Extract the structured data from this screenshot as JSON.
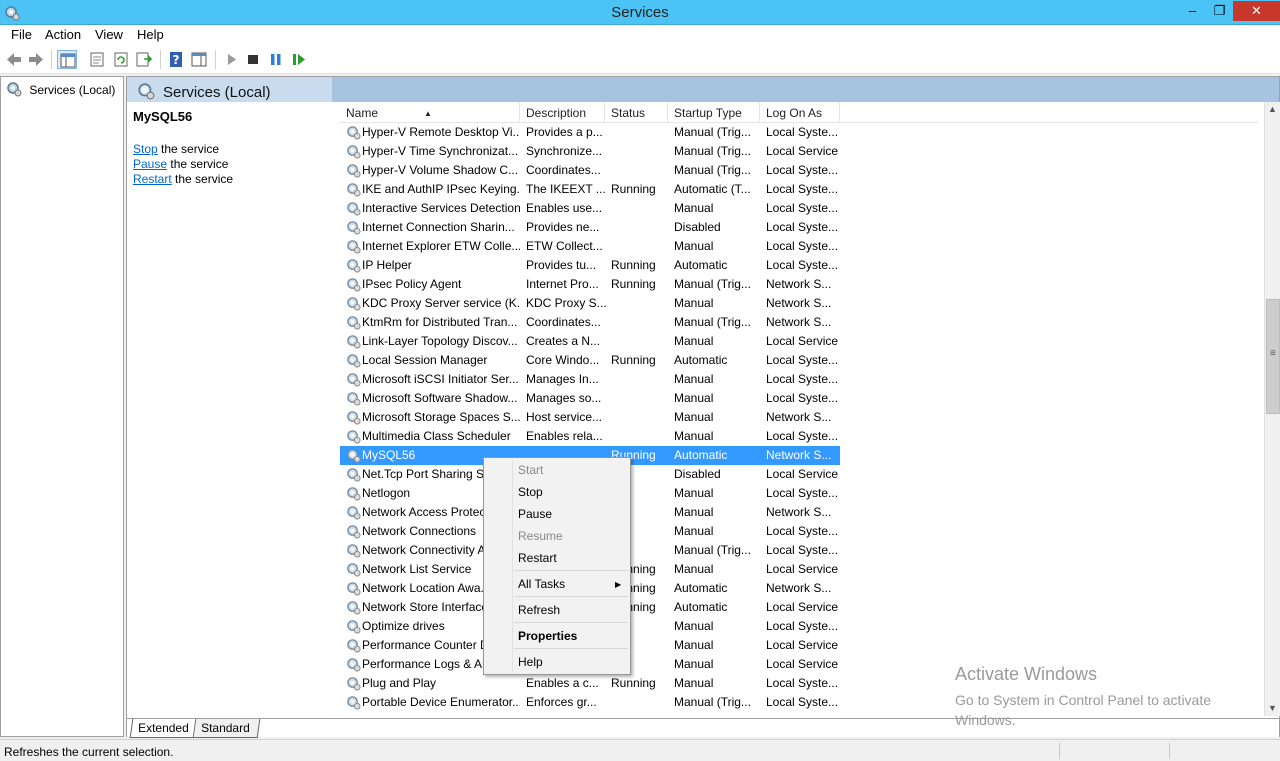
{
  "window": {
    "title": "Services"
  },
  "menubar": {
    "items": [
      "File",
      "Action",
      "View",
      "Help"
    ]
  },
  "tree": {
    "root_label": "Services (Local)"
  },
  "main": {
    "header_title": "Services (Local)",
    "selected_service": "MySQL56",
    "actions": [
      {
        "link": "Stop",
        "rest": "the service"
      },
      {
        "link": "Pause",
        "rest": "the service"
      },
      {
        "link": "Restart",
        "rest": "the service"
      }
    ]
  },
  "table": {
    "columns": [
      "Name",
      "Description",
      "Status",
      "Startup Type",
      "Log On As"
    ],
    "rows": [
      {
        "name": "Hyper-V Remote Desktop Vi...",
        "desc": "Provides a p...",
        "status": "",
        "startup": "Manual (Trig...",
        "logon": "Local Syste..."
      },
      {
        "name": "Hyper-V Time Synchronizat...",
        "desc": "Synchronize...",
        "status": "",
        "startup": "Manual (Trig...",
        "logon": "Local Service"
      },
      {
        "name": "Hyper-V Volume Shadow C...",
        "desc": "Coordinates...",
        "status": "",
        "startup": "Manual (Trig...",
        "logon": "Local Syste..."
      },
      {
        "name": "IKE and AuthIP IPsec Keying...",
        "desc": "The IKEEXT ...",
        "status": "Running",
        "startup": "Automatic (T...",
        "logon": "Local Syste..."
      },
      {
        "name": "Interactive Services Detection",
        "desc": "Enables use...",
        "status": "",
        "startup": "Manual",
        "logon": "Local Syste..."
      },
      {
        "name": "Internet Connection Sharin...",
        "desc": "Provides ne...",
        "status": "",
        "startup": "Disabled",
        "logon": "Local Syste..."
      },
      {
        "name": "Internet Explorer ETW Colle...",
        "desc": "ETW Collect...",
        "status": "",
        "startup": "Manual",
        "logon": "Local Syste..."
      },
      {
        "name": "IP Helper",
        "desc": "Provides tu...",
        "status": "Running",
        "startup": "Automatic",
        "logon": "Local Syste..."
      },
      {
        "name": "IPsec Policy Agent",
        "desc": "Internet Pro...",
        "status": "Running",
        "startup": "Manual (Trig...",
        "logon": "Network S..."
      },
      {
        "name": "KDC Proxy Server service (K...",
        "desc": "KDC Proxy S...",
        "status": "",
        "startup": "Manual",
        "logon": "Network S..."
      },
      {
        "name": "KtmRm for Distributed Tran...",
        "desc": "Coordinates...",
        "status": "",
        "startup": "Manual (Trig...",
        "logon": "Network S..."
      },
      {
        "name": "Link-Layer Topology Discov...",
        "desc": "Creates a N...",
        "status": "",
        "startup": "Manual",
        "logon": "Local Service"
      },
      {
        "name": "Local Session Manager",
        "desc": "Core Windo...",
        "status": "Running",
        "startup": "Automatic",
        "logon": "Local Syste..."
      },
      {
        "name": "Microsoft iSCSI Initiator Ser...",
        "desc": "Manages In...",
        "status": "",
        "startup": "Manual",
        "logon": "Local Syste..."
      },
      {
        "name": "Microsoft Software Shadow...",
        "desc": "Manages so...",
        "status": "",
        "startup": "Manual",
        "logon": "Local Syste..."
      },
      {
        "name": "Microsoft Storage Spaces S...",
        "desc": "Host service...",
        "status": "",
        "startup": "Manual",
        "logon": "Network S..."
      },
      {
        "name": "Multimedia Class Scheduler",
        "desc": "Enables rela...",
        "status": "",
        "startup": "Manual",
        "logon": "Local Syste..."
      },
      {
        "name": "MySQL56",
        "desc": "",
        "status": "Running",
        "startup": "Automatic",
        "logon": "Network S...",
        "selected": true
      },
      {
        "name": "Net.Tcp Port Sharing Se...",
        "desc": "",
        "status": "",
        "startup": "Disabled",
        "logon": "Local Service"
      },
      {
        "name": "Netlogon",
        "desc": "",
        "status": "",
        "startup": "Manual",
        "logon": "Local Syste..."
      },
      {
        "name": "Network Access Protec...",
        "desc": "",
        "status": "",
        "startup": "Manual",
        "logon": "Network S..."
      },
      {
        "name": "Network Connections",
        "desc": "",
        "status": "",
        "startup": "Manual",
        "logon": "Local Syste..."
      },
      {
        "name": "Network Connectivity A...",
        "desc": "",
        "status": "",
        "startup": "Manual (Trig...",
        "logon": "Local Syste..."
      },
      {
        "name": "Network List Service",
        "desc": "",
        "status": "Running",
        "startup": "Manual",
        "logon": "Local Service"
      },
      {
        "name": "Network Location Awa...",
        "desc": "",
        "status": "Running",
        "startup": "Automatic",
        "logon": "Network S..."
      },
      {
        "name": "Network Store Interface...",
        "desc": "",
        "status": "Running",
        "startup": "Automatic",
        "logon": "Local Service"
      },
      {
        "name": "Optimize drives",
        "desc": "",
        "status": "",
        "startup": "Manual",
        "logon": "Local Syste..."
      },
      {
        "name": "Performance Counter D...",
        "desc": "",
        "status": "",
        "startup": "Manual",
        "logon": "Local Service"
      },
      {
        "name": "Performance Logs & Al...",
        "desc": "",
        "status": "",
        "startup": "Manual",
        "logon": "Local Service"
      },
      {
        "name": "Plug and Play",
        "desc": "Enables a c...",
        "status": "Running",
        "startup": "Manual",
        "logon": "Local Syste..."
      },
      {
        "name": "Portable Device Enumerator...",
        "desc": "Enforces gr...",
        "status": "",
        "startup": "Manual (Trig...",
        "logon": "Local Syste..."
      }
    ]
  },
  "context_menu": {
    "start": "Start",
    "stop": "Stop",
    "pause": "Pause",
    "resume": "Resume",
    "restart": "Restart",
    "all_tasks": "All Tasks",
    "refresh": "Refresh",
    "properties": "Properties",
    "help": "Help"
  },
  "bottom_tabs": {
    "extended": "Extended",
    "standard": "Standard"
  },
  "statusbar": {
    "text": "Refreshes the current selection."
  },
  "watermark": {
    "line1": "Activate Windows",
    "line2": "Go to System in Control Panel to activate Windows."
  },
  "colors": {
    "titlebar": "#4cc3f5",
    "selection": "#3399ff",
    "link": "#0066cc",
    "close": "#c7372a"
  }
}
